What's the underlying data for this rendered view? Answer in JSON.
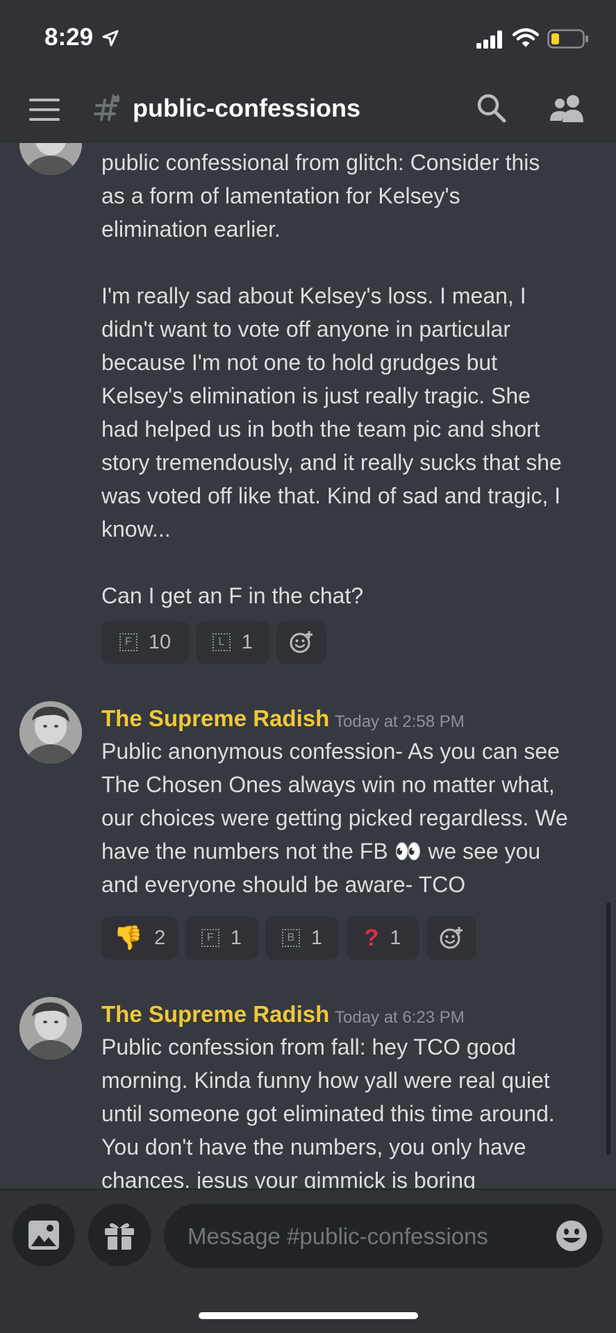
{
  "status_bar": {
    "time": "8:29"
  },
  "header": {
    "channel_name": "public-confessions"
  },
  "messages": [
    {
      "content": "public confessional from glitch: Consider this\nas a form of lamentation for Kelsey's\nelimination earlier.\n\nI'm really sad about Kelsey's loss. I mean, I\ndidn't want to vote off anyone in particular\nbecause I'm not one to hold grudges but\nKelsey's elimination is just really tragic. She\nhad helped us in both the team pic and short\nstory tremendously, and it really sucks that she\nwas voted off like that. Kind of sad and tragic, I\nknow...\n\nCan I get an F in the chat?",
      "reactions": [
        {
          "emoji": "F",
          "count": "10"
        },
        {
          "emoji": "L",
          "count": "1"
        }
      ]
    },
    {
      "author": "The Supreme Radish",
      "timestamp": "Today at 2:58 PM",
      "content": "Public anonymous confession- As you can see\nThe Chosen Ones always win no matter what,\nour choices were getting picked regardless. We\nhave the numbers not the FB 👀 we see you\nand everyone should be aware- TCO",
      "reactions": [
        {
          "emoji": "👎",
          "count": "2"
        },
        {
          "emoji": "F",
          "count": "1"
        },
        {
          "emoji": "B",
          "count": "1"
        },
        {
          "emoji": "?",
          "count": "1"
        }
      ]
    },
    {
      "author": "The Supreme Radish",
      "timestamp": "Today at 6:23 PM",
      "content": "Public confession from fall: hey TCO good\nmorning. Kinda funny how yall were real quiet\nuntil someone got eliminated this time around.\nYou don't have the numbers, you only have\nchances. jesus your gimmick is boring"
    }
  ],
  "composer": {
    "placeholder": "Message #public-confessions"
  },
  "colors": {
    "background": "#36393f",
    "author_name": "#f0c837",
    "bars": "#303236"
  }
}
